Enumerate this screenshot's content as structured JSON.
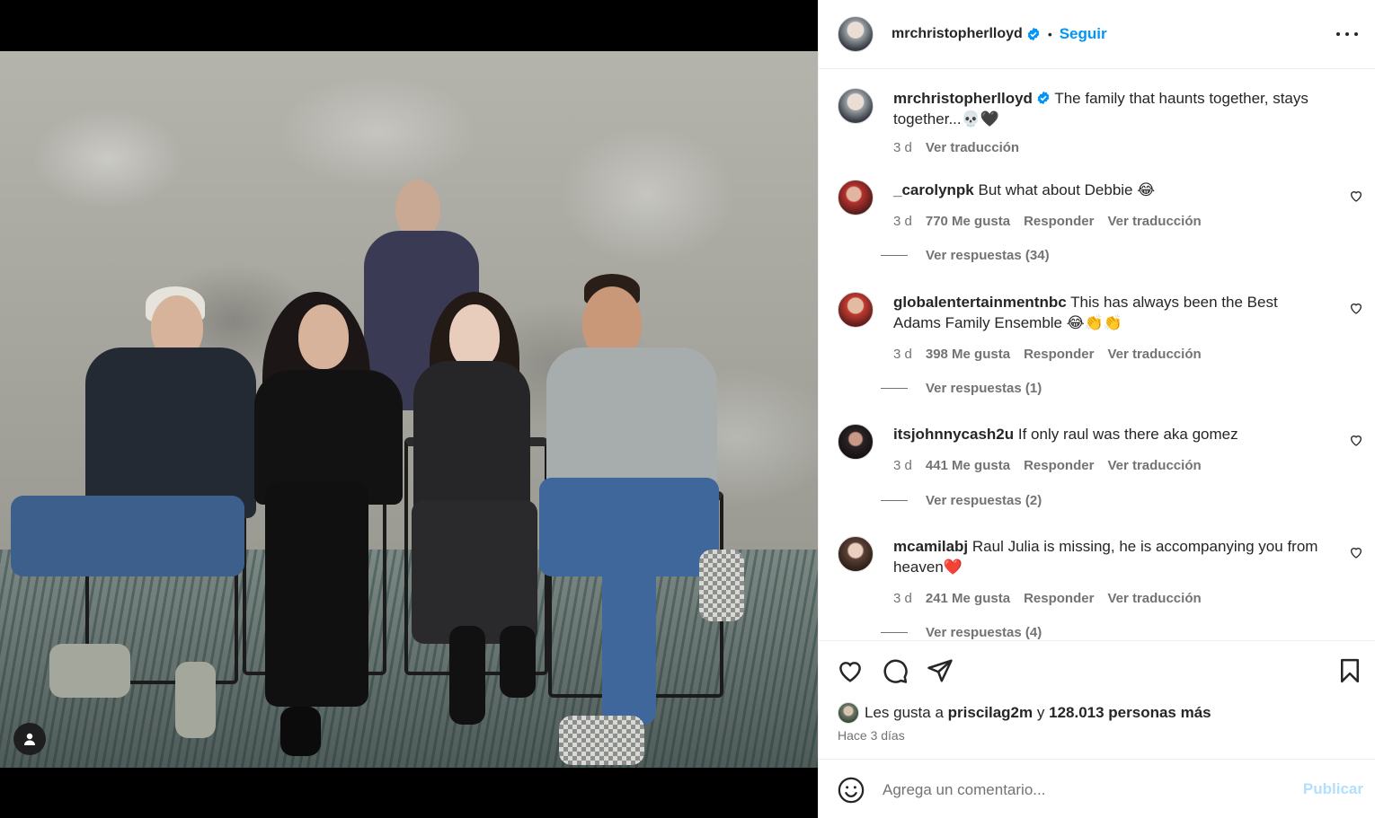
{
  "post": {
    "username": "mrchristopherlloyd",
    "follow_label": "Seguir",
    "dot": "•",
    "caption": "The family that haunts together, stays together...💀🖤",
    "caption_time": "3 d",
    "caption_translate": "Ver traducción"
  },
  "comments": [
    {
      "username": "_carolynpk",
      "text": "But what about Debbie 😂",
      "time": "3 d",
      "likes": "770 Me gusta",
      "reply": "Responder",
      "translate": "Ver traducción",
      "replies": "Ver respuestas (34)"
    },
    {
      "username": "globalentertainmentnbc",
      "text": "This has always been the Best Adams Family Ensemble 😂👏👏",
      "time": "3 d",
      "likes": "398 Me gusta",
      "reply": "Responder",
      "translate": "Ver traducción",
      "replies": "Ver respuestas (1)"
    },
    {
      "username": "itsjohnnycash2u",
      "text": "If only raul was there aka gomez",
      "time": "3 d",
      "likes": "441 Me gusta",
      "reply": "Responder",
      "translate": "Ver traducción",
      "replies": "Ver respuestas (2)"
    },
    {
      "username": "mcamilabj",
      "text": "Raul Julia is missing, he is accompanying you from heaven❤️",
      "time": "3 d",
      "likes": "241 Me gusta",
      "reply": "Responder",
      "translate": "Ver traducción",
      "replies": "Ver respuestas (4)"
    }
  ],
  "likes_line": {
    "prefix": "Les gusta a",
    "user": "priscilag2m",
    "joiner": "y",
    "others": "128.013 personas más"
  },
  "post_time": "Hace 3 días",
  "add_comment": {
    "placeholder": "Agrega un comentario...",
    "publish": "Publicar"
  },
  "icons": {
    "like": "heart-icon",
    "comment": "comment-icon",
    "share": "send-icon",
    "save": "bookmark-icon",
    "more": "more-options-icon",
    "emoji": "emoji-icon",
    "verified": "verified-badge-icon",
    "tag": "user-tag-icon"
  },
  "colors": {
    "accent": "#0095f6",
    "publish_disabled": "#b2dffc",
    "secondary_text": "#737373",
    "verified": "#0095f6"
  }
}
